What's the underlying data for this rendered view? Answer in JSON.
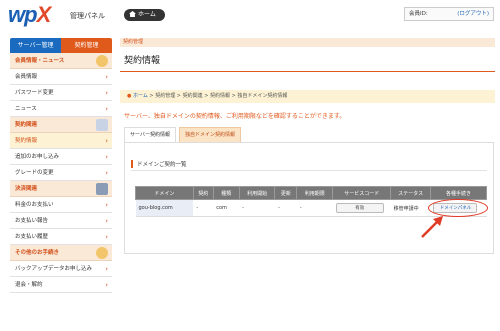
{
  "header": {
    "logo_main": "wp",
    "logo_x": "X",
    "logo_sub": "管理パネル",
    "home_label": "ホーム",
    "member_id_label": "会員ID:",
    "logout_label": "(ログアウト)"
  },
  "sidebar": {
    "tab_server": "サーバー管理",
    "tab_contract": "契約管理",
    "groups": [
      {
        "section": "会員情報・ニュース",
        "icon": "user-icon",
        "items": [
          "会員情報",
          "パスワード変更",
          "ニュース"
        ]
      },
      {
        "section": "契約関連",
        "icon": "document-pen-icon",
        "items": [
          "契約情報",
          "追加のお申し込み",
          "グレードの変更"
        ]
      },
      {
        "section": "決済関連",
        "icon": "calculator-icon",
        "items": [
          "料金のお支払い",
          "お支払い報告",
          "お支払い履歴"
        ]
      },
      {
        "section": "その他のお手続き",
        "icon": "smile-icon",
        "items": [
          "バックアップデータお申し込み",
          "退会・解約"
        ]
      }
    ],
    "active_item": "契約情報"
  },
  "main": {
    "top_crumb": "契約管理",
    "title": "契約情報",
    "breadcrumb": [
      "ホーム",
      "契約管理",
      "契約関連",
      "契約情報",
      "独自ドメイン契約情報"
    ],
    "notice": "サーバー、独自ドメインの契約情報、ご利用期限などを確認することができます。",
    "tabs": [
      "サーバー契約情報",
      "独自ドメイン契約情報"
    ],
    "panel_title": "ドメインご契約一覧",
    "table": {
      "headers": [
        "ドメイン",
        "契約",
        "種類",
        "利用開始",
        "更新",
        "利用期限",
        "サービスコード",
        "ステータス",
        "各種手続き"
      ],
      "rows": [
        {
          "domain": "gou-blog.com",
          "contract": "-",
          "type": "com",
          "start": "-",
          "renew": "-",
          "expiry": "-",
          "service_code": "有効",
          "status": "移管申請中",
          "action": "ドメインパネル"
        }
      ]
    }
  },
  "colors": {
    "brand_blue": "#1a6bbf",
    "brand_orange": "#e05a1c",
    "highlight_red": "#e03b26"
  }
}
